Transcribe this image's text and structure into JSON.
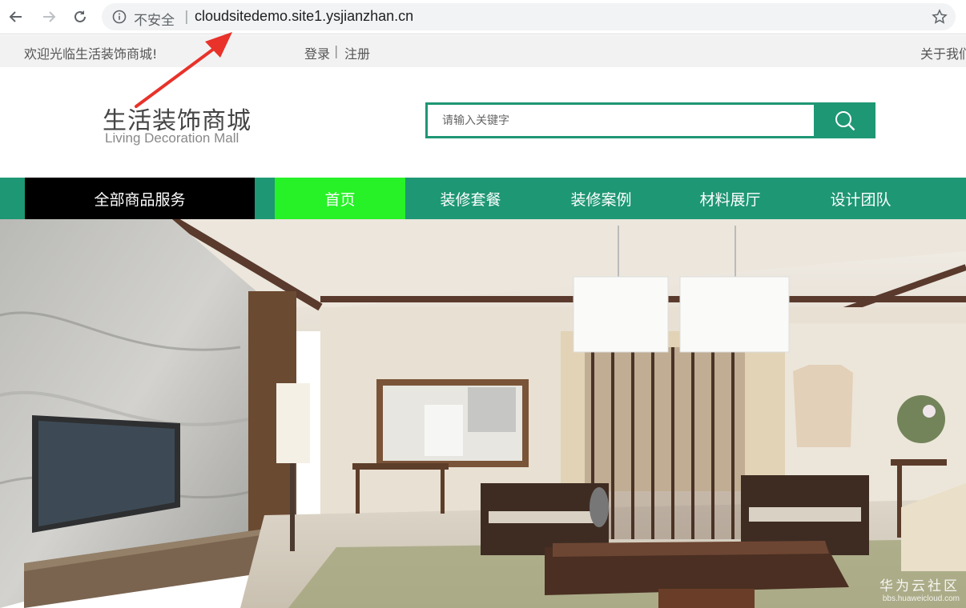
{
  "browser": {
    "security_label": "不安全",
    "separator": "|",
    "url": "cloudsitedemo.site1.ysjianzhan.cn"
  },
  "topbar": {
    "welcome": "欢迎光临生活装饰商城!",
    "login": "登录",
    "separator": "|",
    "register": "注册",
    "about": "关于我们"
  },
  "header": {
    "logo_cn": "生活装饰商城",
    "logo_en": "Living Decoration Mall",
    "search_placeholder": "请输入关键字"
  },
  "nav": {
    "all_goods": "全部商品服务",
    "items": [
      {
        "label": "首页",
        "active": true
      },
      {
        "label": "装修套餐"
      },
      {
        "label": "装修案例"
      },
      {
        "label": "材料展厅"
      },
      {
        "label": "设计团队"
      }
    ]
  },
  "watermark": {
    "main": "华为云社区",
    "sub": "bbs.huaweicloud.com"
  },
  "colors": {
    "brand_green": "#1e9774",
    "active_nav": "#27f127",
    "annotation_arrow": "#e8322a"
  },
  "icons": [
    "back-arrow-icon",
    "forward-arrow-icon",
    "reload-icon",
    "info-icon",
    "star-icon",
    "search-icon"
  ]
}
